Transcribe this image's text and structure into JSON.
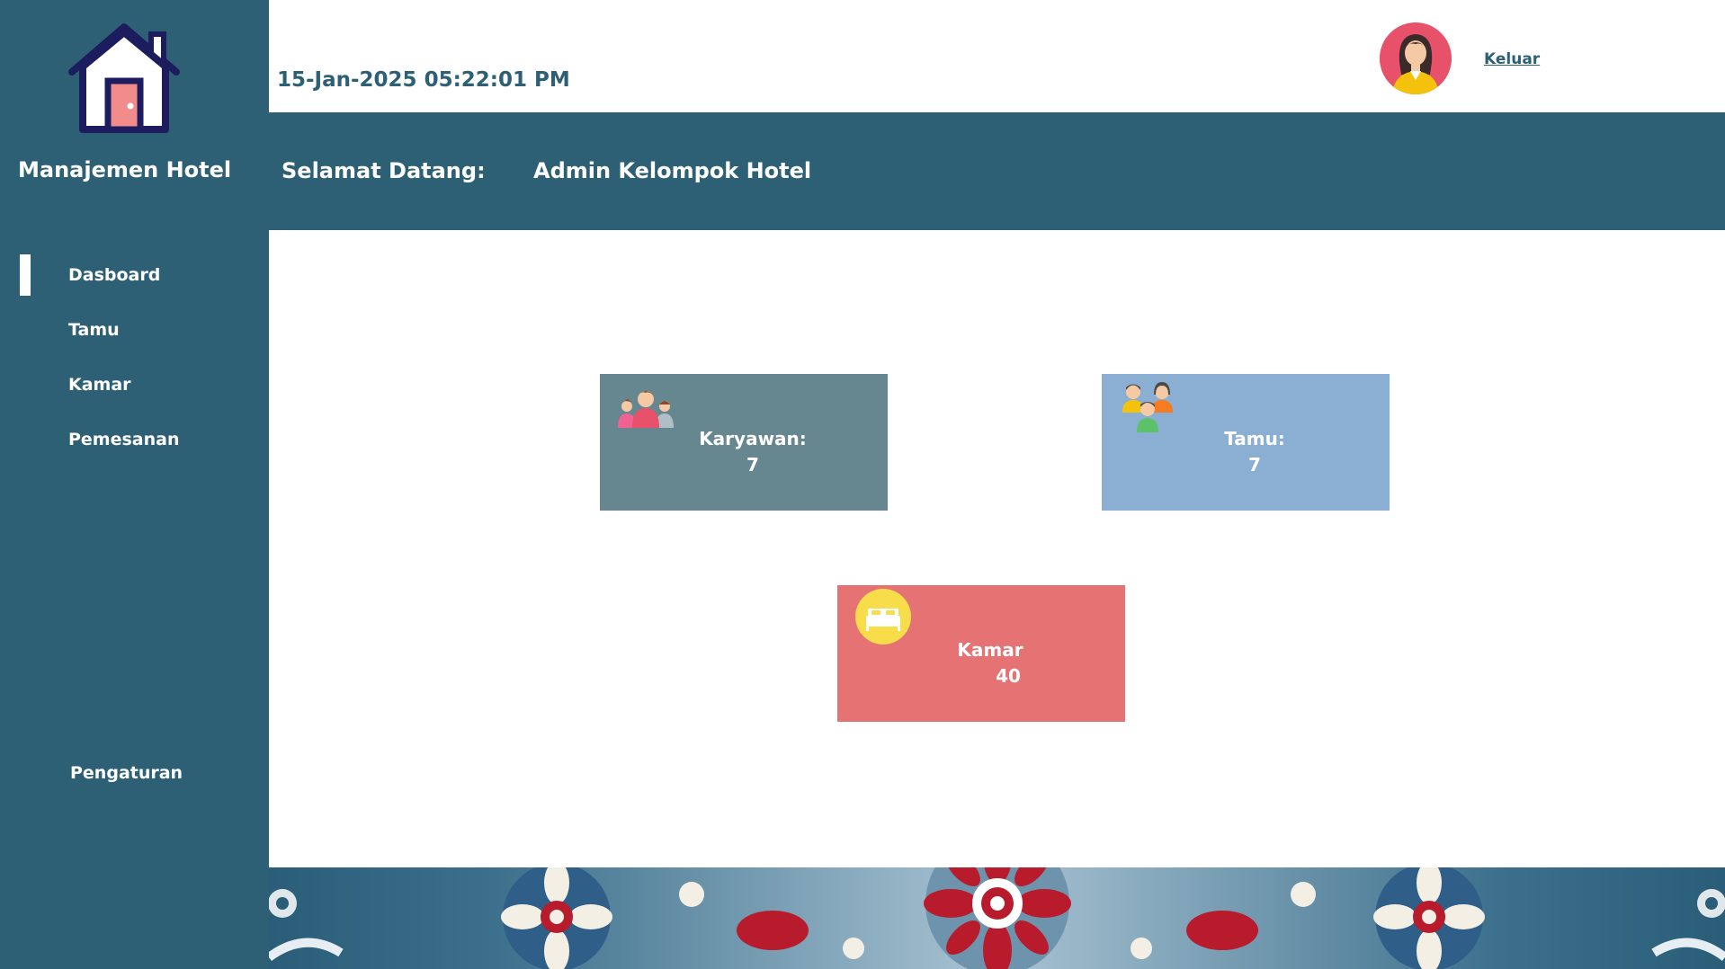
{
  "app": {
    "name": "Manajemen Hotel"
  },
  "sidebar": {
    "items": [
      {
        "label": "Dasboard",
        "active": true
      },
      {
        "label": "Tamu",
        "active": false
      },
      {
        "label": "Kamar",
        "active": false
      },
      {
        "label": "Pemesanan",
        "active": false
      }
    ],
    "settings_label": "Pengaturan"
  },
  "header": {
    "datetime": "15-Jan-2025 05:22:01 PM",
    "logout_label": "Keluar"
  },
  "welcome": {
    "label": "Selamat Datang:",
    "user": "Admin Kelompok Hotel"
  },
  "cards": {
    "employees": {
      "label": "Karyawan:",
      "value": "7"
    },
    "guests": {
      "label": "Tamu:",
      "value": "7"
    },
    "rooms": {
      "label": "Kamar",
      "value": "40"
    }
  },
  "colors": {
    "sidebar": "#2e6075",
    "employees_card": "#66878f",
    "guests_card": "#8aafd3",
    "rooms_card": "#e57373",
    "avatar_bg": "#e8516a"
  },
  "icons": {
    "logo": "house-icon",
    "avatar": "user-avatar-icon",
    "employees": "people-group-icon",
    "guests": "guests-group-icon",
    "rooms": "bed-icon"
  }
}
